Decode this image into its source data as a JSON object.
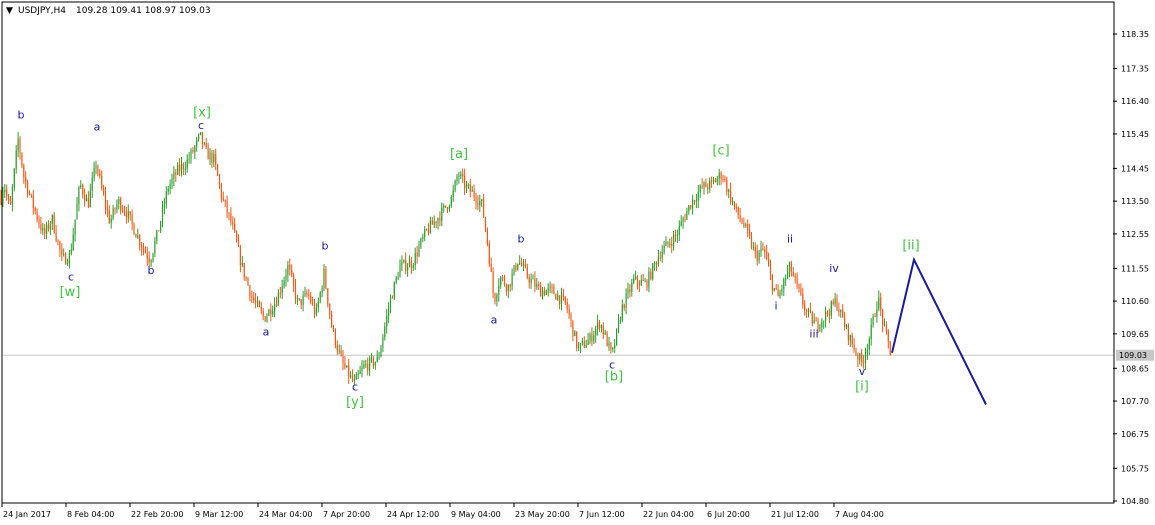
{
  "header": {
    "symbol": "USDJPY,H4",
    "ohlc": "109.28 109.41 108.97 109.03",
    "marker": "▼"
  },
  "colors": {
    "background": "#ffffff",
    "frame": "#000000",
    "bull": "#2e9e2e",
    "bear": "#ef5a17",
    "grid": "#c8c8c8",
    "price_line": "#c8c8c8",
    "wave_blue": "#1a1a9a",
    "wave_green": "#3ec43e",
    "projection": "#1a1a9a"
  },
  "chart_data": {
    "type": "candlestick",
    "symbol": "USDJPY",
    "timeframe": "H4",
    "title": "USDJPY,H4",
    "current_price": 109.03,
    "current_price_label": "109.03",
    "ylim": [
      104.8,
      119.0
    ],
    "y_ticks": [
      "118.35",
      "117.35",
      "116.40",
      "115.45",
      "114.45",
      "113.50",
      "112.55",
      "111.55",
      "110.60",
      "109.65",
      "108.65",
      "107.70",
      "106.75",
      "105.75",
      "104.80"
    ],
    "x_ticks": [
      "24 Jan 2017",
      "8 Feb 04:00",
      "22 Feb 20:00",
      "9 Mar 12:00",
      "24 Mar 04:00",
      "7 Apr 20:00",
      "24 Apr 12:00",
      "9 May 04:00",
      "23 May 20:00",
      "7 Jun 12:00",
      "22 Jun 04:00",
      "6 Jul 20:00",
      "21 Jul 12:00",
      "7 Aug 04:00"
    ],
    "price_path": [
      [
        0,
        113.5
      ],
      [
        4,
        114.0
      ],
      [
        10,
        113.2
      ],
      [
        18,
        115.3
      ],
      [
        24,
        114.2
      ],
      [
        34,
        113.3
      ],
      [
        44,
        112.5
      ],
      [
        52,
        113.0
      ],
      [
        62,
        111.8
      ],
      [
        70,
        111.9
      ],
      [
        80,
        114.0
      ],
      [
        88,
        113.4
      ],
      [
        96,
        114.6
      ],
      [
        102,
        113.8
      ],
      [
        110,
        112.9
      ],
      [
        118,
        113.5
      ],
      [
        126,
        113.2
      ],
      [
        134,
        112.7
      ],
      [
        142,
        112.2
      ],
      [
        150,
        111.8
      ],
      [
        158,
        112.6
      ],
      [
        168,
        113.9
      ],
      [
        178,
        114.4
      ],
      [
        186,
        114.6
      ],
      [
        194,
        115.0
      ],
      [
        200,
        115.4
      ],
      [
        206,
        114.9
      ],
      [
        214,
        114.7
      ],
      [
        222,
        113.6
      ],
      [
        232,
        112.8
      ],
      [
        242,
        111.6
      ],
      [
        252,
        110.7
      ],
      [
        264,
        110.1
      ],
      [
        276,
        110.6
      ],
      [
        288,
        111.6
      ],
      [
        298,
        110.5
      ],
      [
        308,
        110.8
      ],
      [
        316,
        110.2
      ],
      [
        324,
        111.4
      ],
      [
        332,
        109.8
      ],
      [
        342,
        108.8
      ],
      [
        354,
        108.2
      ],
      [
        364,
        108.7
      ],
      [
        378,
        108.9
      ],
      [
        390,
        110.6
      ],
      [
        400,
        111.6
      ],
      [
        412,
        111.7
      ],
      [
        426,
        112.6
      ],
      [
        440,
        113.1
      ],
      [
        452,
        113.6
      ],
      [
        458,
        114.3
      ],
      [
        466,
        113.9
      ],
      [
        474,
        113.7
      ],
      [
        482,
        113.4
      ],
      [
        488,
        112.2
      ],
      [
        494,
        110.6
      ],
      [
        500,
        111.3
      ],
      [
        508,
        111.0
      ],
      [
        518,
        111.8
      ],
      [
        528,
        111.3
      ],
      [
        540,
        110.9
      ],
      [
        552,
        110.9
      ],
      [
        566,
        110.5
      ],
      [
        578,
        109.2
      ],
      [
        590,
        109.5
      ],
      [
        600,
        110.0
      ],
      [
        612,
        109.0
      ],
      [
        622,
        110.4
      ],
      [
        634,
        111.2
      ],
      [
        646,
        111.1
      ],
      [
        660,
        112.0
      ],
      [
        676,
        112.5
      ],
      [
        690,
        113.4
      ],
      [
        702,
        113.9
      ],
      [
        712,
        114.0
      ],
      [
        722,
        114.3
      ],
      [
        728,
        113.8
      ],
      [
        736,
        113.2
      ],
      [
        744,
        112.8
      ],
      [
        756,
        111.9
      ],
      [
        764,
        112.1
      ],
      [
        772,
        111.1
      ],
      [
        778,
        110.7
      ],
      [
        790,
        111.6
      ],
      [
        798,
        110.9
      ],
      [
        806,
        110.3
      ],
      [
        816,
        109.9
      ],
      [
        826,
        110.2
      ],
      [
        836,
        110.6
      ],
      [
        846,
        109.8
      ],
      [
        856,
        109.1
      ],
      [
        862,
        108.8
      ],
      [
        870,
        109.6
      ],
      [
        878,
        110.7
      ],
      [
        884,
        109.8
      ],
      [
        892,
        109.03
      ]
    ],
    "projection": [
      [
        892,
        109.1
      ],
      [
        914,
        111.8
      ],
      [
        986,
        107.6
      ]
    ],
    "wave_labels": [
      {
        "text": "b",
        "x": 21,
        "y": 115.9,
        "color": "blue"
      },
      {
        "text": "a",
        "x": 97,
        "y": 115.55,
        "color": "blue"
      },
      {
        "text": "[x]",
        "x": 202,
        "y": 115.95,
        "color": "green"
      },
      {
        "text": "c",
        "x": 201,
        "y": 115.6,
        "color": "blue"
      },
      {
        "text": "c",
        "x": 71,
        "y": 111.2,
        "color": "blue"
      },
      {
        "text": "[w]",
        "x": 70,
        "y": 110.75,
        "color": "green"
      },
      {
        "text": "b",
        "x": 151,
        "y": 111.38,
        "color": "blue"
      },
      {
        "text": "b",
        "x": 325,
        "y": 112.1,
        "color": "blue"
      },
      {
        "text": "a",
        "x": 266,
        "y": 109.6,
        "color": "blue"
      },
      {
        "text": "c",
        "x": 355,
        "y": 108.0,
        "color": "blue"
      },
      {
        "text": "[y]",
        "x": 355,
        "y": 107.55,
        "color": "green"
      },
      {
        "text": "[a]",
        "x": 459,
        "y": 114.75,
        "color": "green"
      },
      {
        "text": "b",
        "x": 521,
        "y": 112.3,
        "color": "blue"
      },
      {
        "text": "a",
        "x": 494,
        "y": 109.95,
        "color": "blue"
      },
      {
        "text": "c",
        "x": 612,
        "y": 108.65,
        "color": "blue"
      },
      {
        "text": "[b]",
        "x": 614,
        "y": 108.3,
        "color": "green"
      },
      {
        "text": "[c]",
        "x": 721,
        "y": 114.85,
        "color": "green"
      },
      {
        "text": "ii",
        "x": 790,
        "y": 112.3,
        "color": "blue"
      },
      {
        "text": "i",
        "x": 776,
        "y": 110.35,
        "color": "blue"
      },
      {
        "text": "iv",
        "x": 834,
        "y": 111.45,
        "color": "blue"
      },
      {
        "text": "iii",
        "x": 814,
        "y": 109.55,
        "color": "blue"
      },
      {
        "text": "v",
        "x": 862,
        "y": 108.45,
        "color": "blue"
      },
      {
        "text": "[i]",
        "x": 862,
        "y": 108.0,
        "color": "green"
      },
      {
        "text": "[ii]",
        "x": 911,
        "y": 112.1,
        "color": "green"
      }
    ]
  }
}
